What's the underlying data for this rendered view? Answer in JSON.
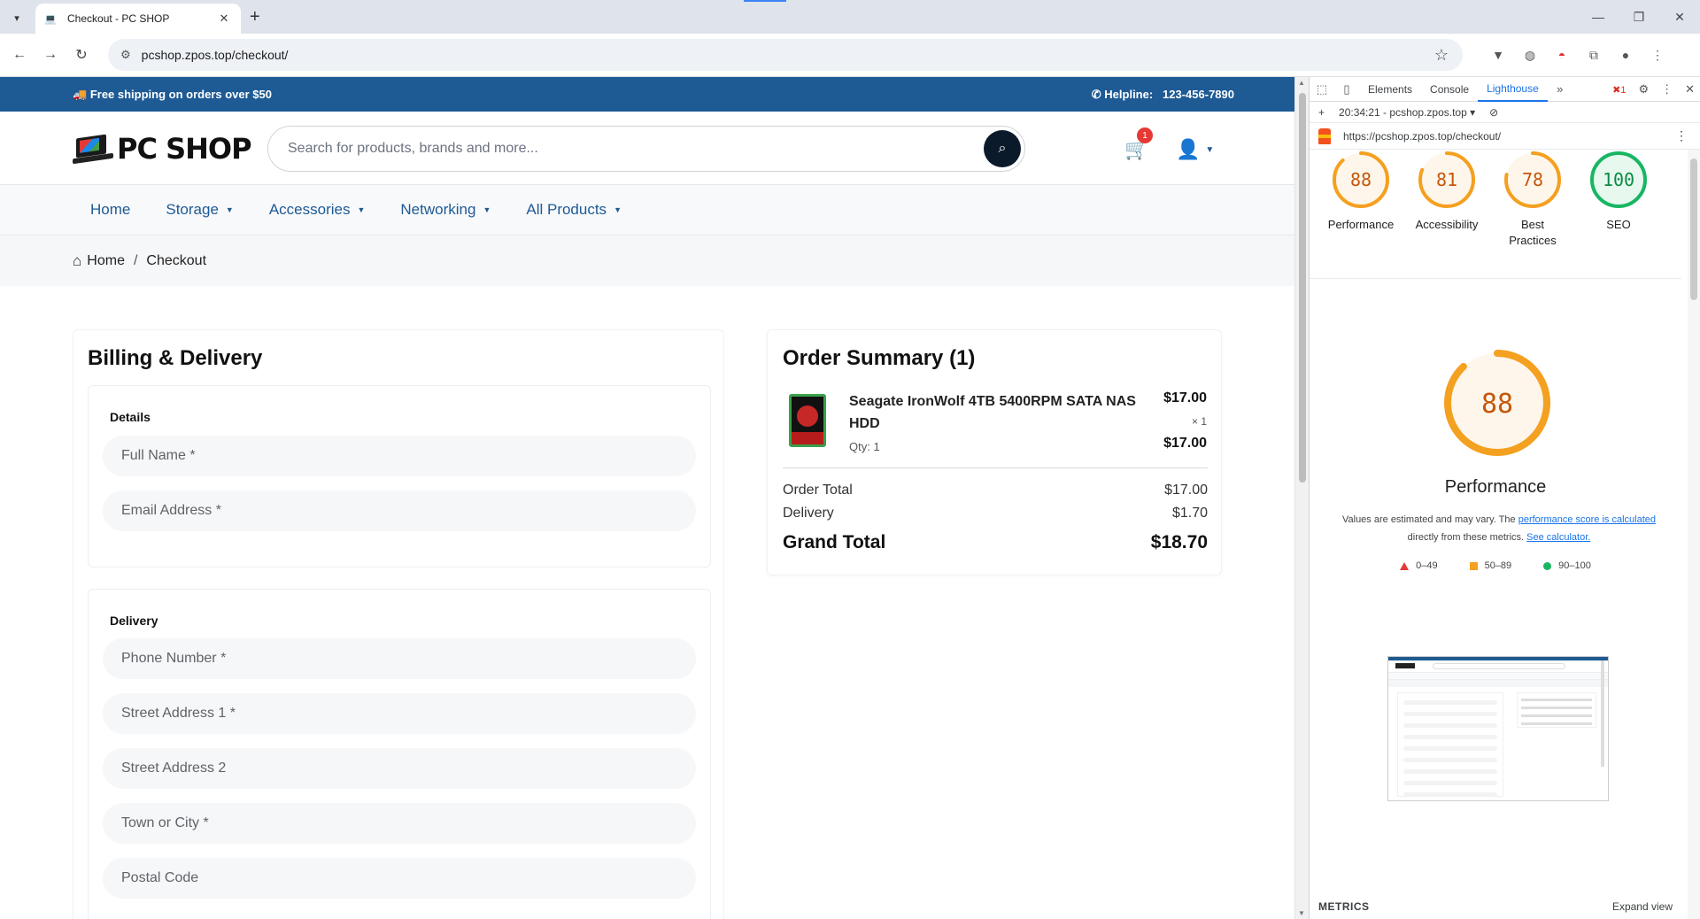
{
  "browser": {
    "tab_title": "Checkout - PC SHOP",
    "url": "pcshop.zpos.top/checkout/"
  },
  "topbar": {
    "shipping_text": "Free shipping on orders over $50",
    "helpline_label": "Helpline:",
    "helpline_number": "123-456-7890"
  },
  "header": {
    "logo_text": "PC SHOP",
    "search_placeholder": "Search for products, brands and more...",
    "cart_count": "1"
  },
  "nav": {
    "items": [
      {
        "label": "Home",
        "dropdown": false
      },
      {
        "label": "Storage",
        "dropdown": true
      },
      {
        "label": "Accessories",
        "dropdown": true
      },
      {
        "label": "Networking",
        "dropdown": true
      },
      {
        "label": "All Products",
        "dropdown": true
      }
    ]
  },
  "breadcrumb": {
    "home": "Home",
    "sep": "/",
    "current": "Checkout"
  },
  "billing": {
    "title": "Billing & Delivery",
    "details_title": "Details",
    "details_fields": {
      "full_name": "Full Name *",
      "email": "Email Address *"
    },
    "delivery_title": "Delivery",
    "delivery_fields": {
      "phone": "Phone Number *",
      "street1": "Street Address 1 *",
      "street2": "Street Address 2",
      "town": "Town or City *",
      "postal": "Postal Code"
    }
  },
  "summary": {
    "title": "Order Summary (1)",
    "item": {
      "name": "Seagate IronWolf 4TB 5400RPM SATA NAS HDD",
      "qty": "Qty: 1",
      "price": "$17.00",
      "times": "× 1",
      "line_total": "$17.00"
    },
    "order_total_label": "Order Total",
    "order_total": "$17.00",
    "delivery_label": "Delivery",
    "delivery": "$1.70",
    "grand_total_label": "Grand Total",
    "grand_total": "$18.70"
  },
  "devtools": {
    "tabs": [
      "Elements",
      "Console",
      "Lighthouse"
    ],
    "active_tab": "Lighthouse",
    "error_count": "1",
    "report_select": "20:34:21 - pcshop.zpos.top",
    "report_url": "https://pcshop.zpos.top/checkout/",
    "scores": [
      {
        "label": "Performance",
        "score": 88,
        "color": "#f4a020"
      },
      {
        "label": "Accessibility",
        "score": 81,
        "color": "#f4a020"
      },
      {
        "label": "Best Practices",
        "score": 78,
        "color": "#f4a020"
      },
      {
        "label": "SEO",
        "score": 100,
        "color": "#18b663"
      }
    ],
    "main_score": 88,
    "main_label": "Performance",
    "note_prefix": "Values are estimated and may vary. The ",
    "note_link1": "performance score is calculated",
    "note_middle": " directly from these metrics. ",
    "note_link2": "See calculator.",
    "legend": {
      "fail": "0–49",
      "average": "50–89",
      "pass": "90–100"
    },
    "metrics_title": "METRICS",
    "expand_view": "Expand view"
  }
}
